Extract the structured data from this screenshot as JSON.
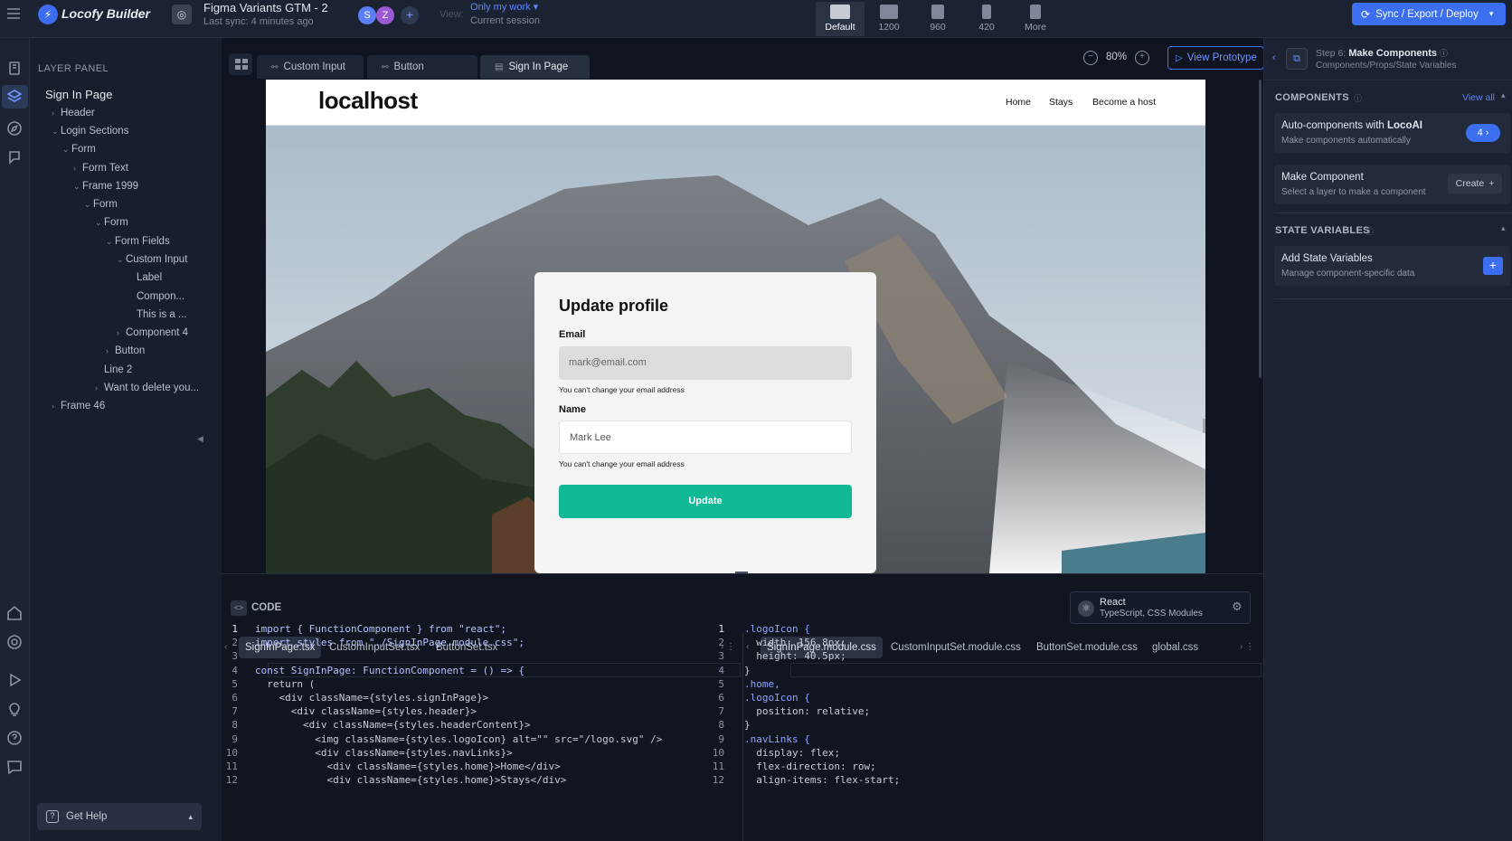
{
  "topbar": {
    "app_name": "Locofy Builder",
    "project_title": "Figma Variants GTM - 2",
    "last_sync": "Last sync: 4 minutes ago",
    "avatars": [
      "S",
      "Z"
    ],
    "view_label": "View:",
    "view_value": "Only my work",
    "view_sub": "Current session",
    "devices": [
      "Default",
      "1200",
      "960",
      "420",
      "More"
    ],
    "sync_button": "Sync / Export / Deploy"
  },
  "layer_panel": {
    "title": "LAYER PANEL",
    "page_name": "Sign In Page",
    "items": [
      "Header",
      "Login Sections",
      "Form",
      "Form Text",
      "Frame 1999",
      "Form",
      "Form",
      "Form Fields",
      "Custom Input",
      "Label",
      "Compon...",
      "This is a ...",
      "Component 4",
      "Button",
      "Line 2",
      "Want to delete you...",
      "Frame 46"
    ],
    "help": "Get Help"
  },
  "canvas": {
    "tabs": [
      "Custom Input",
      "Button",
      "Sign In Page"
    ],
    "zoom": "80%",
    "view_prototype": "View Prototype"
  },
  "preview": {
    "logo": "localhost",
    "nav": [
      "Home",
      "Stays",
      "Become a host"
    ],
    "form_title": "Update profile",
    "email_label": "Email",
    "email_value": "mark@email.com",
    "email_hint": "You can't change your email address",
    "name_label": "Name",
    "name_value": "Mark Lee",
    "name_hint": "You can't change your email address",
    "button": "Update"
  },
  "right_panel": {
    "step_prefix": "Step 6:",
    "step_title": "Make Components",
    "step_sub": "Components/Props/State Variables",
    "components_title": "COMPONENTS",
    "view_all": "View all",
    "auto_title": "Auto-components with",
    "auto_brand": "LocoAI",
    "auto_sub": "Make components automatically",
    "auto_count": "4",
    "make_title": "Make Component",
    "make_sub": "Select a layer to make a component",
    "create": "Create",
    "state_title": "STATE VARIABLES",
    "add_state": "Add State Variables",
    "add_state_sub": "Manage component-specific data"
  },
  "code": {
    "title": "CODE",
    "framework": "React",
    "framework_sub": "TypeScript, CSS Modules",
    "left_files": [
      "SignInPage.tsx",
      "CustomInputSet.tsx",
      "ButtonSet.tsx"
    ],
    "right_files": [
      "SignInPage.module.css",
      "CustomInputSet.module.css",
      "ButtonSet.module.css",
      "global.css"
    ],
    "left_lines": [
      "import { FunctionComponent } from \"react\";",
      "import styles from \"./SignInPage.module.css\";",
      "",
      "const SignInPage: FunctionComponent = () => {",
      "  return (",
      "    <div className={styles.signInPage}>",
      "      <div className={styles.header}>",
      "        <div className={styles.headerContent}>",
      "          <img className={styles.logoIcon} alt=\"\" src=\"/logo.svg\" />",
      "          <div className={styles.navLinks}>",
      "            <div className={styles.home}>Home</div>",
      "            <div className={styles.home}>Stays</div>"
    ],
    "right_lines": [
      ".logoIcon {",
      "  width: 156.8px;",
      "  height: 40.5px;",
      "}",
      ".home,",
      ".logoIcon {",
      "  position: relative;",
      "}",
      ".navLinks {",
      "  display: flex;",
      "  flex-direction: row;",
      "  align-items: flex-start;"
    ]
  }
}
